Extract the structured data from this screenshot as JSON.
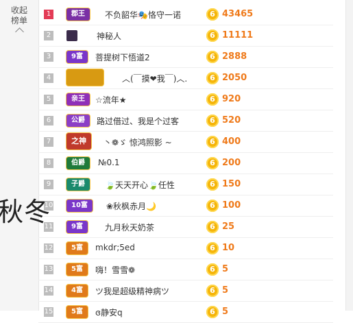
{
  "sidebar": {
    "collapse_line1": "收起",
    "collapse_line2": "榜单"
  },
  "overlay_text": "秋冬",
  "colors": {
    "coin": "#f5b50a",
    "score": "#ef7a1a",
    "rank_top": "#e33b56",
    "rank_default": "#bdbdbd"
  },
  "rows": [
    {
      "rank": "1",
      "badge": "郡王",
      "badge_color": "#7a2fa5",
      "name": "不负韶华🎭恪守一诺",
      "score": "43465"
    },
    {
      "rank": "2",
      "badge": "",
      "badge_color": "",
      "icon": "mystery-person-icon",
      "name": "神秘人",
      "score": "11111"
    },
    {
      "rank": "3",
      "badge": "9富",
      "badge_color": "#7a36c9",
      "name": "菩提树下悟道2",
      "score": "2888"
    },
    {
      "rank": "4",
      "badge": "",
      "badge_color": "#d89a12",
      "icon": "crown-badge-icon",
      "name": "︿(￣摸❤我￣)︿.",
      "score": "2050"
    },
    {
      "rank": "5",
      "badge": "亲王",
      "badge_color": "#8f2fb8",
      "name": "☆流年★",
      "score": "920"
    },
    {
      "rank": "6",
      "badge": "公爵",
      "badge_color": "#8b3fc6",
      "name": "路过借过、我是个过客",
      "score": "520"
    },
    {
      "rank": "7",
      "badge": "之神",
      "badge_color": "#c0392b",
      "name": "丶❁ゞ 惊鸿照影 ~",
      "score": "400"
    },
    {
      "rank": "8",
      "badge": "伯爵",
      "badge_color": "#1f7a3a",
      "name": "№0.1",
      "score": "200"
    },
    {
      "rank": "9",
      "badge": "子爵",
      "badge_color": "#1a8a6c",
      "name": "🍃天天开心🍃任性",
      "score": "150"
    },
    {
      "rank": "10",
      "badge": "10富",
      "badge_color": "#7a36c9",
      "name": "❀秋枫赤月🌙",
      "score": "100"
    },
    {
      "rank": "11",
      "badge": "9富",
      "badge_color": "#7a36c9",
      "name": "九月秋天奶茶",
      "score": "25"
    },
    {
      "rank": "12",
      "badge": "5富",
      "badge_color": "#e07a1a",
      "name": "mkdr;5ed",
      "score": "10"
    },
    {
      "rank": "13",
      "badge": "5富",
      "badge_color": "#e07a1a",
      "name": "嗨！雪雪❁",
      "score": "5"
    },
    {
      "rank": "14",
      "badge": "4富",
      "badge_color": "#e07a1a",
      "name": "ツ我是超级精神病ツ",
      "score": "5"
    },
    {
      "rank": "15",
      "badge": "5富",
      "badge_color": "#e07a1a",
      "name": "ɞ静安q",
      "score": "5"
    }
  ]
}
